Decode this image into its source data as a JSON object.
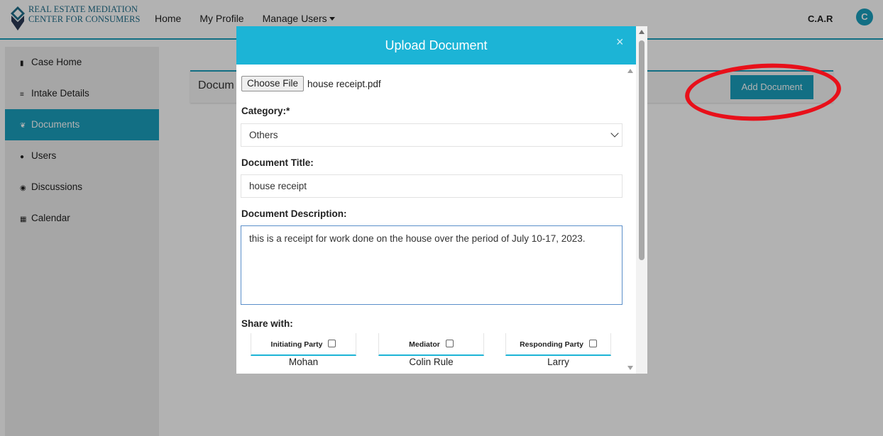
{
  "brand": {
    "logo_line1": "REAL ESTATE MEDIATION",
    "logo_line2": "CENTER FOR CONSUMERS"
  },
  "nav": {
    "home": "Home",
    "my_profile": "My Profile",
    "manage_users": "Manage Users"
  },
  "user": {
    "name": "C.A.R",
    "avatar_letter": "C"
  },
  "sidebar": {
    "items": [
      {
        "label": "Case Home",
        "icon": "file-icon"
      },
      {
        "label": "Intake Details",
        "icon": "list-icon"
      },
      {
        "label": "Documents",
        "icon": "paperclip-icon"
      },
      {
        "label": "Users",
        "icon": "users-icon"
      },
      {
        "label": "Discussions",
        "icon": "comment-icon"
      },
      {
        "label": "Calendar",
        "icon": "calendar-icon"
      }
    ],
    "active_index": 2
  },
  "content": {
    "title": "Docum",
    "add_button": "Add Document"
  },
  "modal": {
    "title": "Upload Document",
    "close": "×",
    "choose_file": "Choose File",
    "file_name": "house receipt.pdf",
    "category_label": "Category:*",
    "category_value": "Others",
    "doc_title_label": "Document Title:",
    "doc_title_value": "house receipt",
    "description_label": "Document Description:",
    "description_value": "this is a receipt for work done on the house over the period of July 10-17, 2023.",
    "share_label": "Share with:",
    "parties": [
      {
        "role": "Initiating Party",
        "name": "Mohan"
      },
      {
        "role": "Mediator",
        "name": "Colin Rule"
      },
      {
        "role": "Responding Party",
        "name": "Larry"
      }
    ]
  },
  "colors": {
    "accent": "#1a9fbd",
    "modal_header": "#1cb4d6",
    "annotation_red": "#e8101a"
  }
}
